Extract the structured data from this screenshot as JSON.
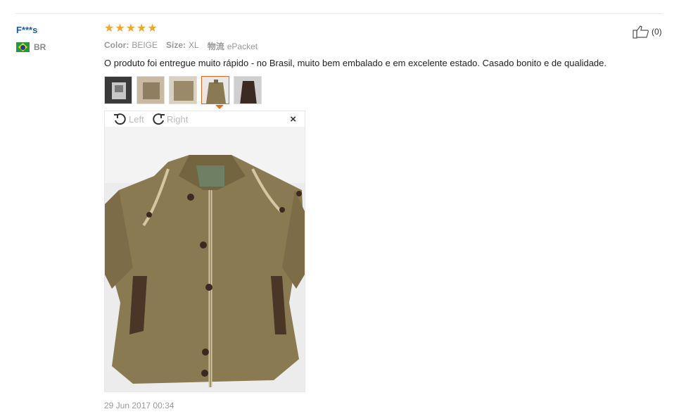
{
  "top_cutoff": "...",
  "buyer": {
    "name": "F***s",
    "country_code": "BR"
  },
  "rating": {
    "stars": 5,
    "max": 5
  },
  "attributes": [
    {
      "key": "Color:",
      "value": "BEIGE"
    },
    {
      "key": "Size:",
      "value": "XL"
    },
    {
      "key": "物流",
      "value": "ePacket"
    }
  ],
  "review_text": "O produto foi entregue muito rápido - no Brasil, muito bem embalado e em excelente estado. Casado bonito e de qualidade.",
  "thumbnails": [
    {
      "name": "thumb-1",
      "active": false
    },
    {
      "name": "thumb-2",
      "active": false
    },
    {
      "name": "thumb-3",
      "active": false
    },
    {
      "name": "thumb-4",
      "active": true
    },
    {
      "name": "thumb-5",
      "active": false
    }
  ],
  "viewer": {
    "rotate_left": "Left",
    "rotate_right": "Right",
    "close": "×"
  },
  "helpful": {
    "count": "(0)"
  },
  "date": "29 Jun 2017 00:34",
  "colors": {
    "accent": "#e46b1b",
    "link": "#1a5ea8",
    "star": "#f5a623",
    "jacket": "#8a7a52"
  }
}
